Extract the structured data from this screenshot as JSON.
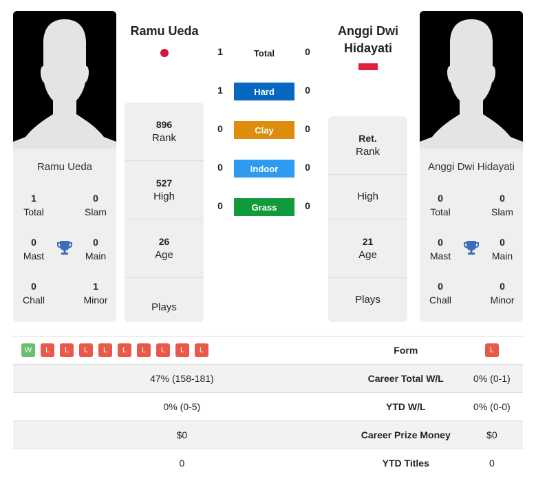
{
  "player1": {
    "name": "Ramu Ueda",
    "flag_color": "#d5153a",
    "titles": {
      "total": {
        "value": "1",
        "label": "Total"
      },
      "slam": {
        "value": "0",
        "label": "Slam"
      },
      "mast": {
        "value": "0",
        "label": "Mast"
      },
      "main": {
        "value": "0",
        "label": "Main"
      },
      "chall": {
        "value": "0",
        "label": "Chall"
      },
      "minor": {
        "value": "1",
        "label": "Minor"
      }
    },
    "stats": {
      "rank": {
        "value": "896",
        "label": "Rank"
      },
      "high": {
        "value": "527",
        "label": "High"
      },
      "age": {
        "value": "26",
        "label": "Age"
      },
      "plays": {
        "value": "",
        "label": "Plays"
      }
    },
    "form": [
      "W",
      "L",
      "L",
      "L",
      "L",
      "L",
      "L",
      "L",
      "L",
      "L"
    ],
    "career_wl": "47% (158-181)",
    "ytd_wl": "0% (0-5)",
    "prize": "$0",
    "ytd_titles": "0"
  },
  "player2": {
    "name": "Anggi Dwi Hidayati",
    "name_line1": "Anggi Dwi",
    "name_line2": "Hidayati",
    "flag_color": "#e0203a",
    "titles": {
      "total": {
        "value": "0",
        "label": "Total"
      },
      "slam": {
        "value": "0",
        "label": "Slam"
      },
      "mast": {
        "value": "0",
        "label": "Mast"
      },
      "main": {
        "value": "0",
        "label": "Main"
      },
      "chall": {
        "value": "0",
        "label": "Chall"
      },
      "minor": {
        "value": "0",
        "label": "Minor"
      }
    },
    "stats": {
      "rank": {
        "value": "Ret.",
        "label": "Rank"
      },
      "high": {
        "value": "",
        "label": "High"
      },
      "age": {
        "value": "21",
        "label": "Age"
      },
      "plays": {
        "value": "",
        "label": "Plays"
      }
    },
    "form": [
      "L"
    ],
    "career_wl": "0% (0-1)",
    "ytd_wl": "0% (0-0)",
    "prize": "$0",
    "ytd_titles": "0"
  },
  "h2h": [
    {
      "label": "Total",
      "p1": "1",
      "p2": "0",
      "color": ""
    },
    {
      "label": "Hard",
      "p1": "1",
      "p2": "0",
      "color": "#0868c0"
    },
    {
      "label": "Clay",
      "p1": "0",
      "p2": "0",
      "color": "#dd8c0b"
    },
    {
      "label": "Indoor",
      "p1": "0",
      "p2": "0",
      "color": "#2e9bf0"
    },
    {
      "label": "Grass",
      "p1": "0",
      "p2": "0",
      "color": "#119a3c"
    }
  ],
  "compare_labels": {
    "form": "Form",
    "career_wl": "Career Total W/L",
    "ytd_wl": "YTD W/L",
    "prize": "Career Prize Money",
    "ytd_titles": "YTD Titles"
  },
  "icons": {
    "trophy": "trophy-icon",
    "trophy_color": "#3d6fb8"
  }
}
